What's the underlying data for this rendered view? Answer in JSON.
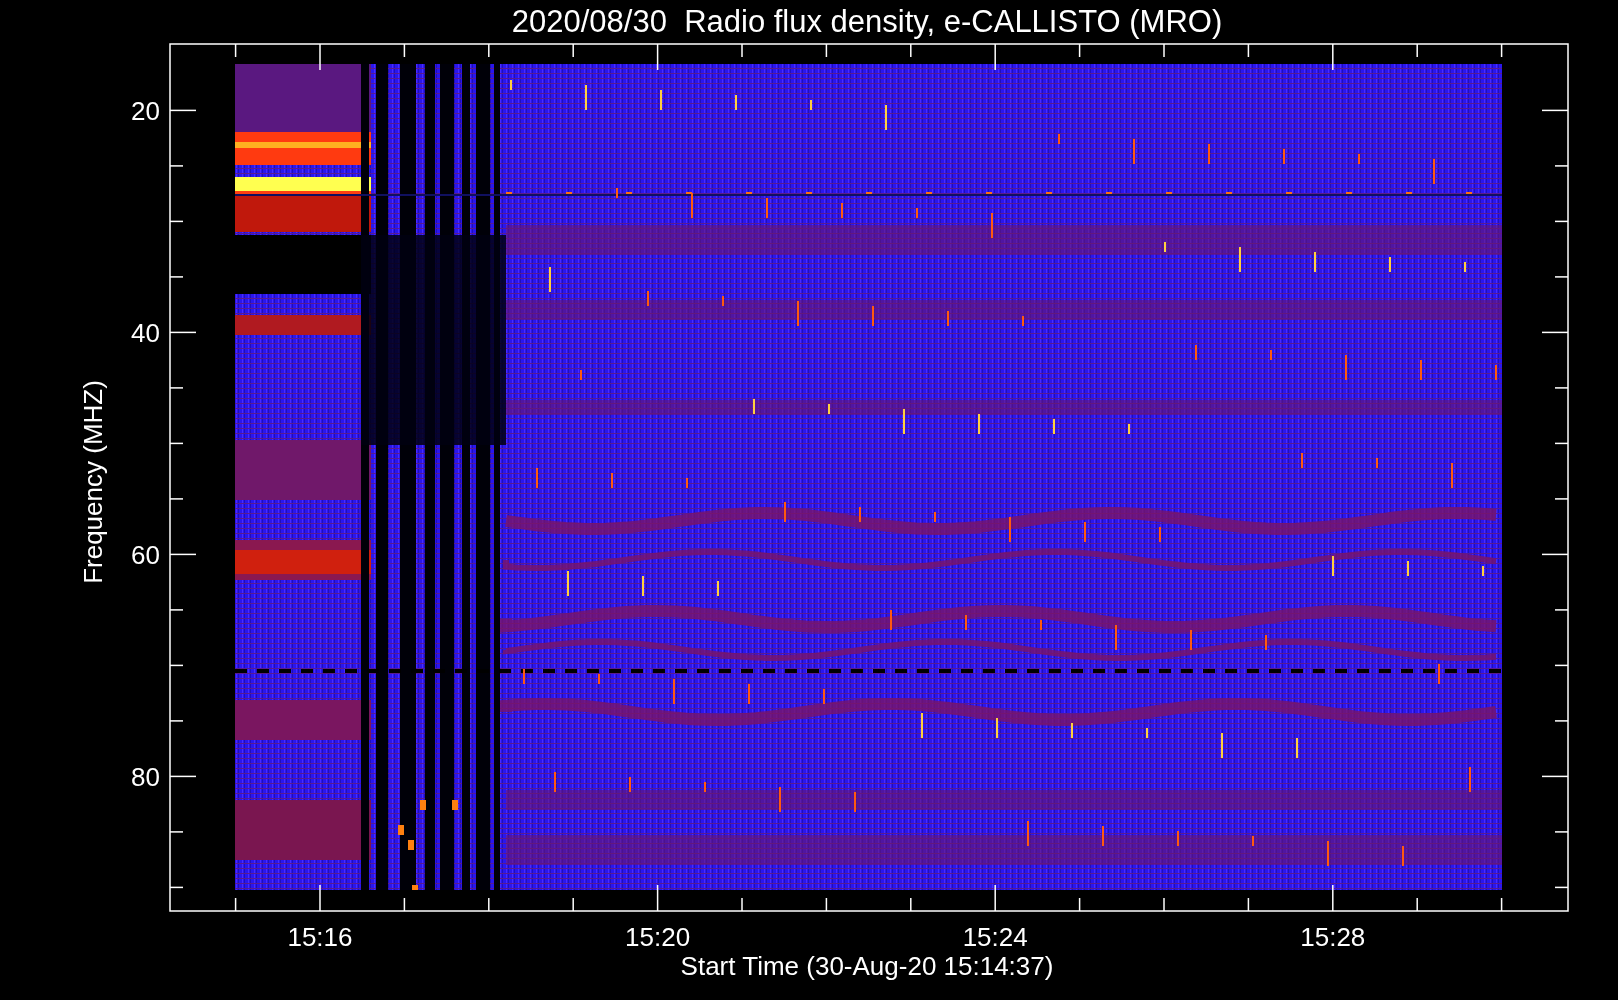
{
  "title": "2020/08/30  Radio flux density, e-CALLISTO (MRO)",
  "y_axis": {
    "label": "Frequency (MHZ)",
    "tick_labels": [
      "20",
      "40",
      "60",
      "80"
    ]
  },
  "x_axis": {
    "label": "Start Time (30-Aug-20 15:14:37)",
    "tick_labels": [
      "15:16",
      "15:20",
      "15:24",
      "15:28"
    ]
  }
}
